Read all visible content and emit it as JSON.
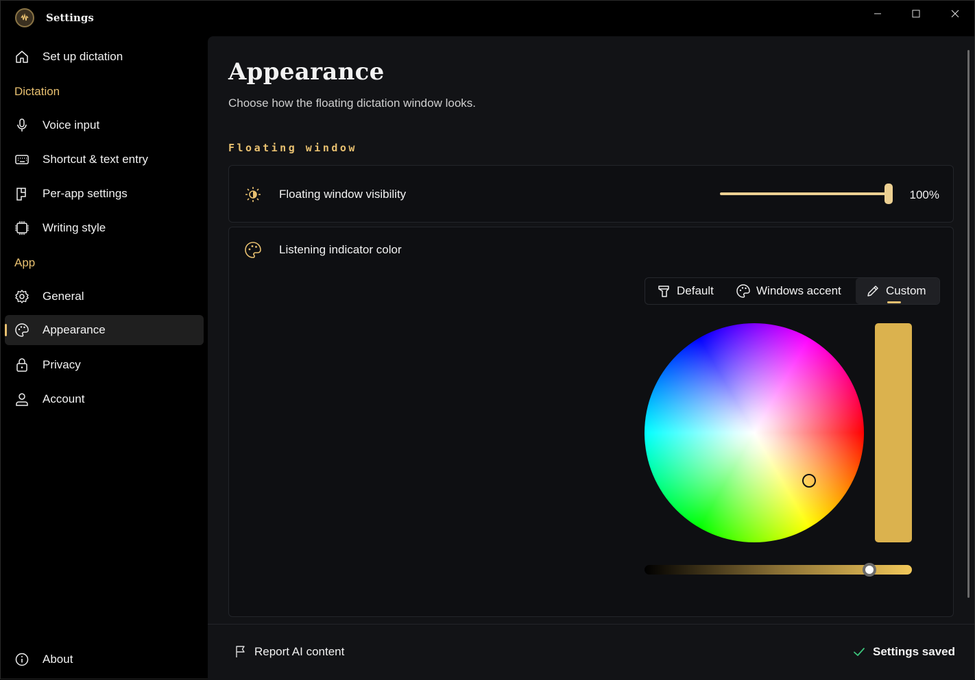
{
  "window": {
    "title": "Settings",
    "icons": {
      "logo": "app-logo-icon",
      "minimize": "minimize-icon",
      "maximize": "maximize-icon",
      "close": "close-icon"
    }
  },
  "sidebar": {
    "top_item": {
      "label": "Set up dictation",
      "icon": "home-icon"
    },
    "sections": [
      {
        "title": "Dictation",
        "items": [
          {
            "label": "Voice input",
            "icon": "microphone-icon"
          },
          {
            "label": "Shortcut & text entry",
            "icon": "keyboard-icon"
          },
          {
            "label": "Per-app settings",
            "icon": "apps-icon"
          },
          {
            "label": "Writing style",
            "icon": "chip-icon"
          }
        ]
      },
      {
        "title": "App",
        "items": [
          {
            "label": "General",
            "icon": "gear-icon"
          },
          {
            "label": "Appearance",
            "icon": "palette-icon",
            "selected": true
          },
          {
            "label": "Privacy",
            "icon": "lock-icon"
          },
          {
            "label": "Account",
            "icon": "person-icon"
          }
        ]
      }
    ],
    "bottom_item": {
      "label": "About",
      "icon": "info-icon"
    }
  },
  "page": {
    "title": "Appearance",
    "subtitle": "Choose how the floating dictation window looks.",
    "section_title": "Floating window",
    "visibility": {
      "label": "Floating window visibility",
      "icon": "brightness-icon",
      "value": 100,
      "value_text": "100%"
    },
    "indicator": {
      "label": "Listening indicator color",
      "icon": "palette-icon",
      "options": [
        {
          "label": "Default",
          "icon": "brush-icon"
        },
        {
          "label": "Windows accent",
          "icon": "palette-icon"
        },
        {
          "label": "Custom",
          "icon": "pencil-icon",
          "selected": true
        }
      ],
      "custom_color": "#dbb24e",
      "brightness_fraction": 0.84
    }
  },
  "footer": {
    "report_label": "Report AI content",
    "report_icon": "flag-icon",
    "status_label": "Settings saved",
    "status_icon": "check-icon"
  },
  "colors": {
    "accent": "#e8c070",
    "background": "#000000",
    "content_bg": "#121316",
    "card_bg": "#0e0f12",
    "selected_nav": "#1f1f1f"
  }
}
